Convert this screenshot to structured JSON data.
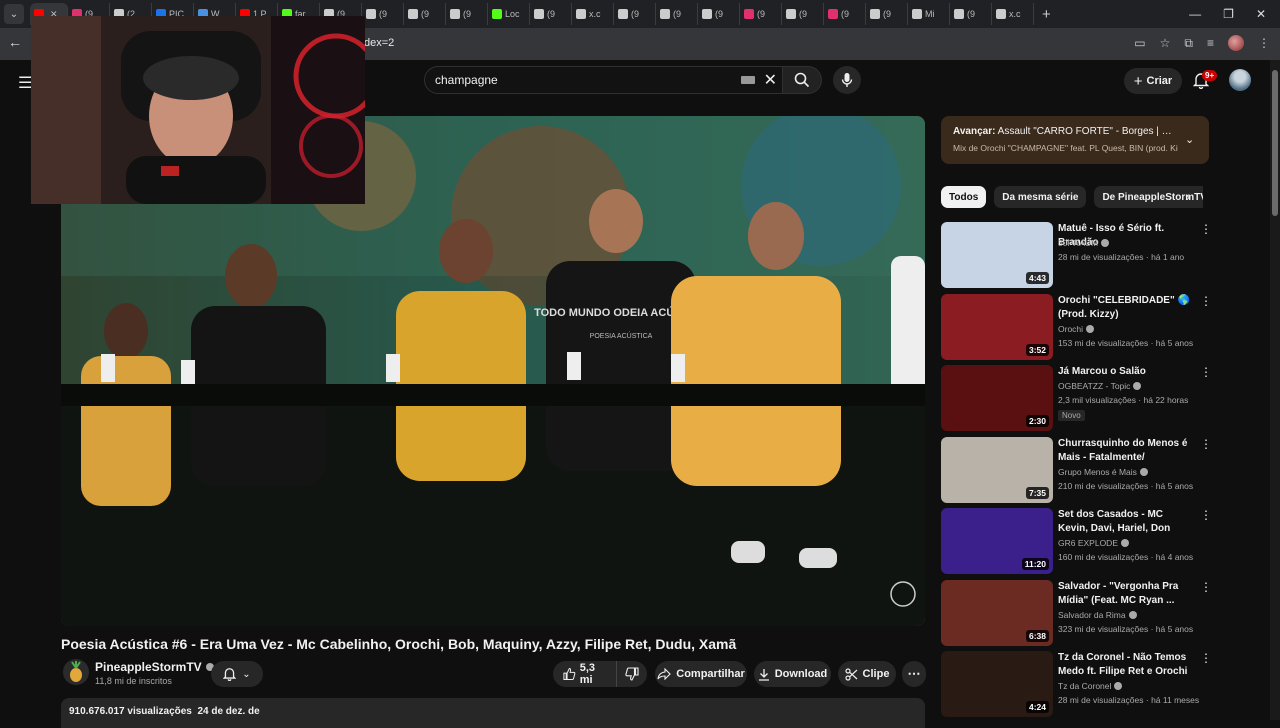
{
  "browser": {
    "tabs": [
      {
        "label": "",
        "color": "#ff0000"
      },
      {
        "label": "(9",
        "color": "#e1306c"
      },
      {
        "label": "(2",
        "color": "#cccccc"
      },
      {
        "label": "PIC",
        "color": "#1a73e8"
      },
      {
        "label": "W",
        "color": "#4a90e2"
      },
      {
        "label": "1 P",
        "color": "#ff0000"
      },
      {
        "label": "far",
        "color": "#53fc18"
      },
      {
        "label": "(9",
        "color": "#cccccc"
      },
      {
        "label": "(9",
        "color": "#cccccc"
      },
      {
        "label": "(9",
        "color": "#cccccc"
      },
      {
        "label": "(9",
        "color": "#cccccc"
      },
      {
        "label": "Loc",
        "color": "#53fc18"
      },
      {
        "label": "(9",
        "color": "#cccccc"
      },
      {
        "label": "x.c",
        "color": "#cccccc"
      },
      {
        "label": "(9",
        "color": "#cccccc"
      },
      {
        "label": "(9",
        "color": "#cccccc"
      },
      {
        "label": "(9",
        "color": "#cccccc"
      },
      {
        "label": "(9",
        "color": "#e1306c"
      },
      {
        "label": "(9",
        "color": "#cccccc"
      },
      {
        "label": "(9",
        "color": "#e1306c"
      },
      {
        "label": "(9",
        "color": "#cccccc"
      },
      {
        "label": "Mi",
        "color": "#cccccc"
      },
      {
        "label": "(9",
        "color": "#cccccc"
      },
      {
        "label": "x.c",
        "color": "#cccccc"
      }
    ],
    "url_fragment": "dex=2"
  },
  "header": {
    "search_value": "champagne",
    "create_label": "Criar",
    "notif_badge": "9+"
  },
  "video": {
    "title": "Poesia Acústica #6 - Era Uma Vez - Mc Cabelinho, Orochi, Bob, Maquiny, Azzy, Filipe Ret, Dudu, Xamã",
    "shirt_text": "TODO MUNDO ODEIA ACÚSTICO",
    "shirt_sub": "POESIA ACÚSTICA",
    "channel": "PineappleStormTV",
    "subscribers": "11,8 mi de inscritos",
    "likes": "5,3 mi",
    "share": "Compartilhar",
    "download": "Download",
    "clip": "Clipe",
    "views": "910.676.017 visualizações",
    "date": "24 de dez. de"
  },
  "sidebar": {
    "next_prefix": "Avançar:",
    "next_title": "Assault \"CARRO FORTE\" - Borges | Orochi ...",
    "next_sub": "Mix de Orochi \"CHAMPAGNE\" feat. PL Quest, BIN (prod. Kizzy)",
    "chips": [
      "Todos",
      "Da mesma série",
      "De PineappleStormTV"
    ],
    "recs": [
      {
        "title": "Matuê - Isso é Sério ft. Brandão",
        "channel": "30PRAUM",
        "meta": "28 mi de visualizações · há 1 ano",
        "duration": "4:43",
        "badge": "",
        "thumb": "#c6d4e6"
      },
      {
        "title": "Orochi \"CELEBRIDADE\" 🌎 (Prod. Kizzy)",
        "channel": "Orochi",
        "meta": "153 mi de visualizações · há 5 anos",
        "duration": "3:52",
        "badge": "",
        "thumb": "#8a1c22"
      },
      {
        "title": "Já Marcou o Salão",
        "channel": "OGBEATZZ - Topic",
        "meta": "2,3 mil visualizações · há 22 horas",
        "duration": "2:30",
        "badge": "Novo",
        "thumb": "#5a1010"
      },
      {
        "title": "Churrasquinho do Menos é Mais - Fatalmente/ Separação...",
        "channel": "Grupo Menos é Mais",
        "meta": "210 mi de visualizações · há 5 anos",
        "duration": "7:35",
        "badge": "",
        "thumb": "#b8b2a8"
      },
      {
        "title": "Set dos Casados - MC Kevin, Davi, Hariel, Don Juan, Kapela,...",
        "channel": "GR6 EXPLODE",
        "meta": "160 mi de visualizações · há 4 anos",
        "duration": "11:20",
        "badge": "",
        "thumb": "#3b1f8a"
      },
      {
        "title": "Salvador - \"Vergonha Pra Mídia\" (Feat. MC Ryan ...",
        "channel": "Salvador da Rima",
        "meta": "323 mi de visualizações · há 5 anos",
        "duration": "6:38",
        "badge": "",
        "thumb": "#6b2a22"
      },
      {
        "title": "Tz da Coronel - Não Temos Medo ft. Filipe Ret e Orochi ...",
        "channel": "Tz da Coronel",
        "meta": "28 mi de visualizações · há 11 meses",
        "duration": "4:24",
        "badge": "",
        "thumb": "#2a1a14"
      }
    ]
  }
}
